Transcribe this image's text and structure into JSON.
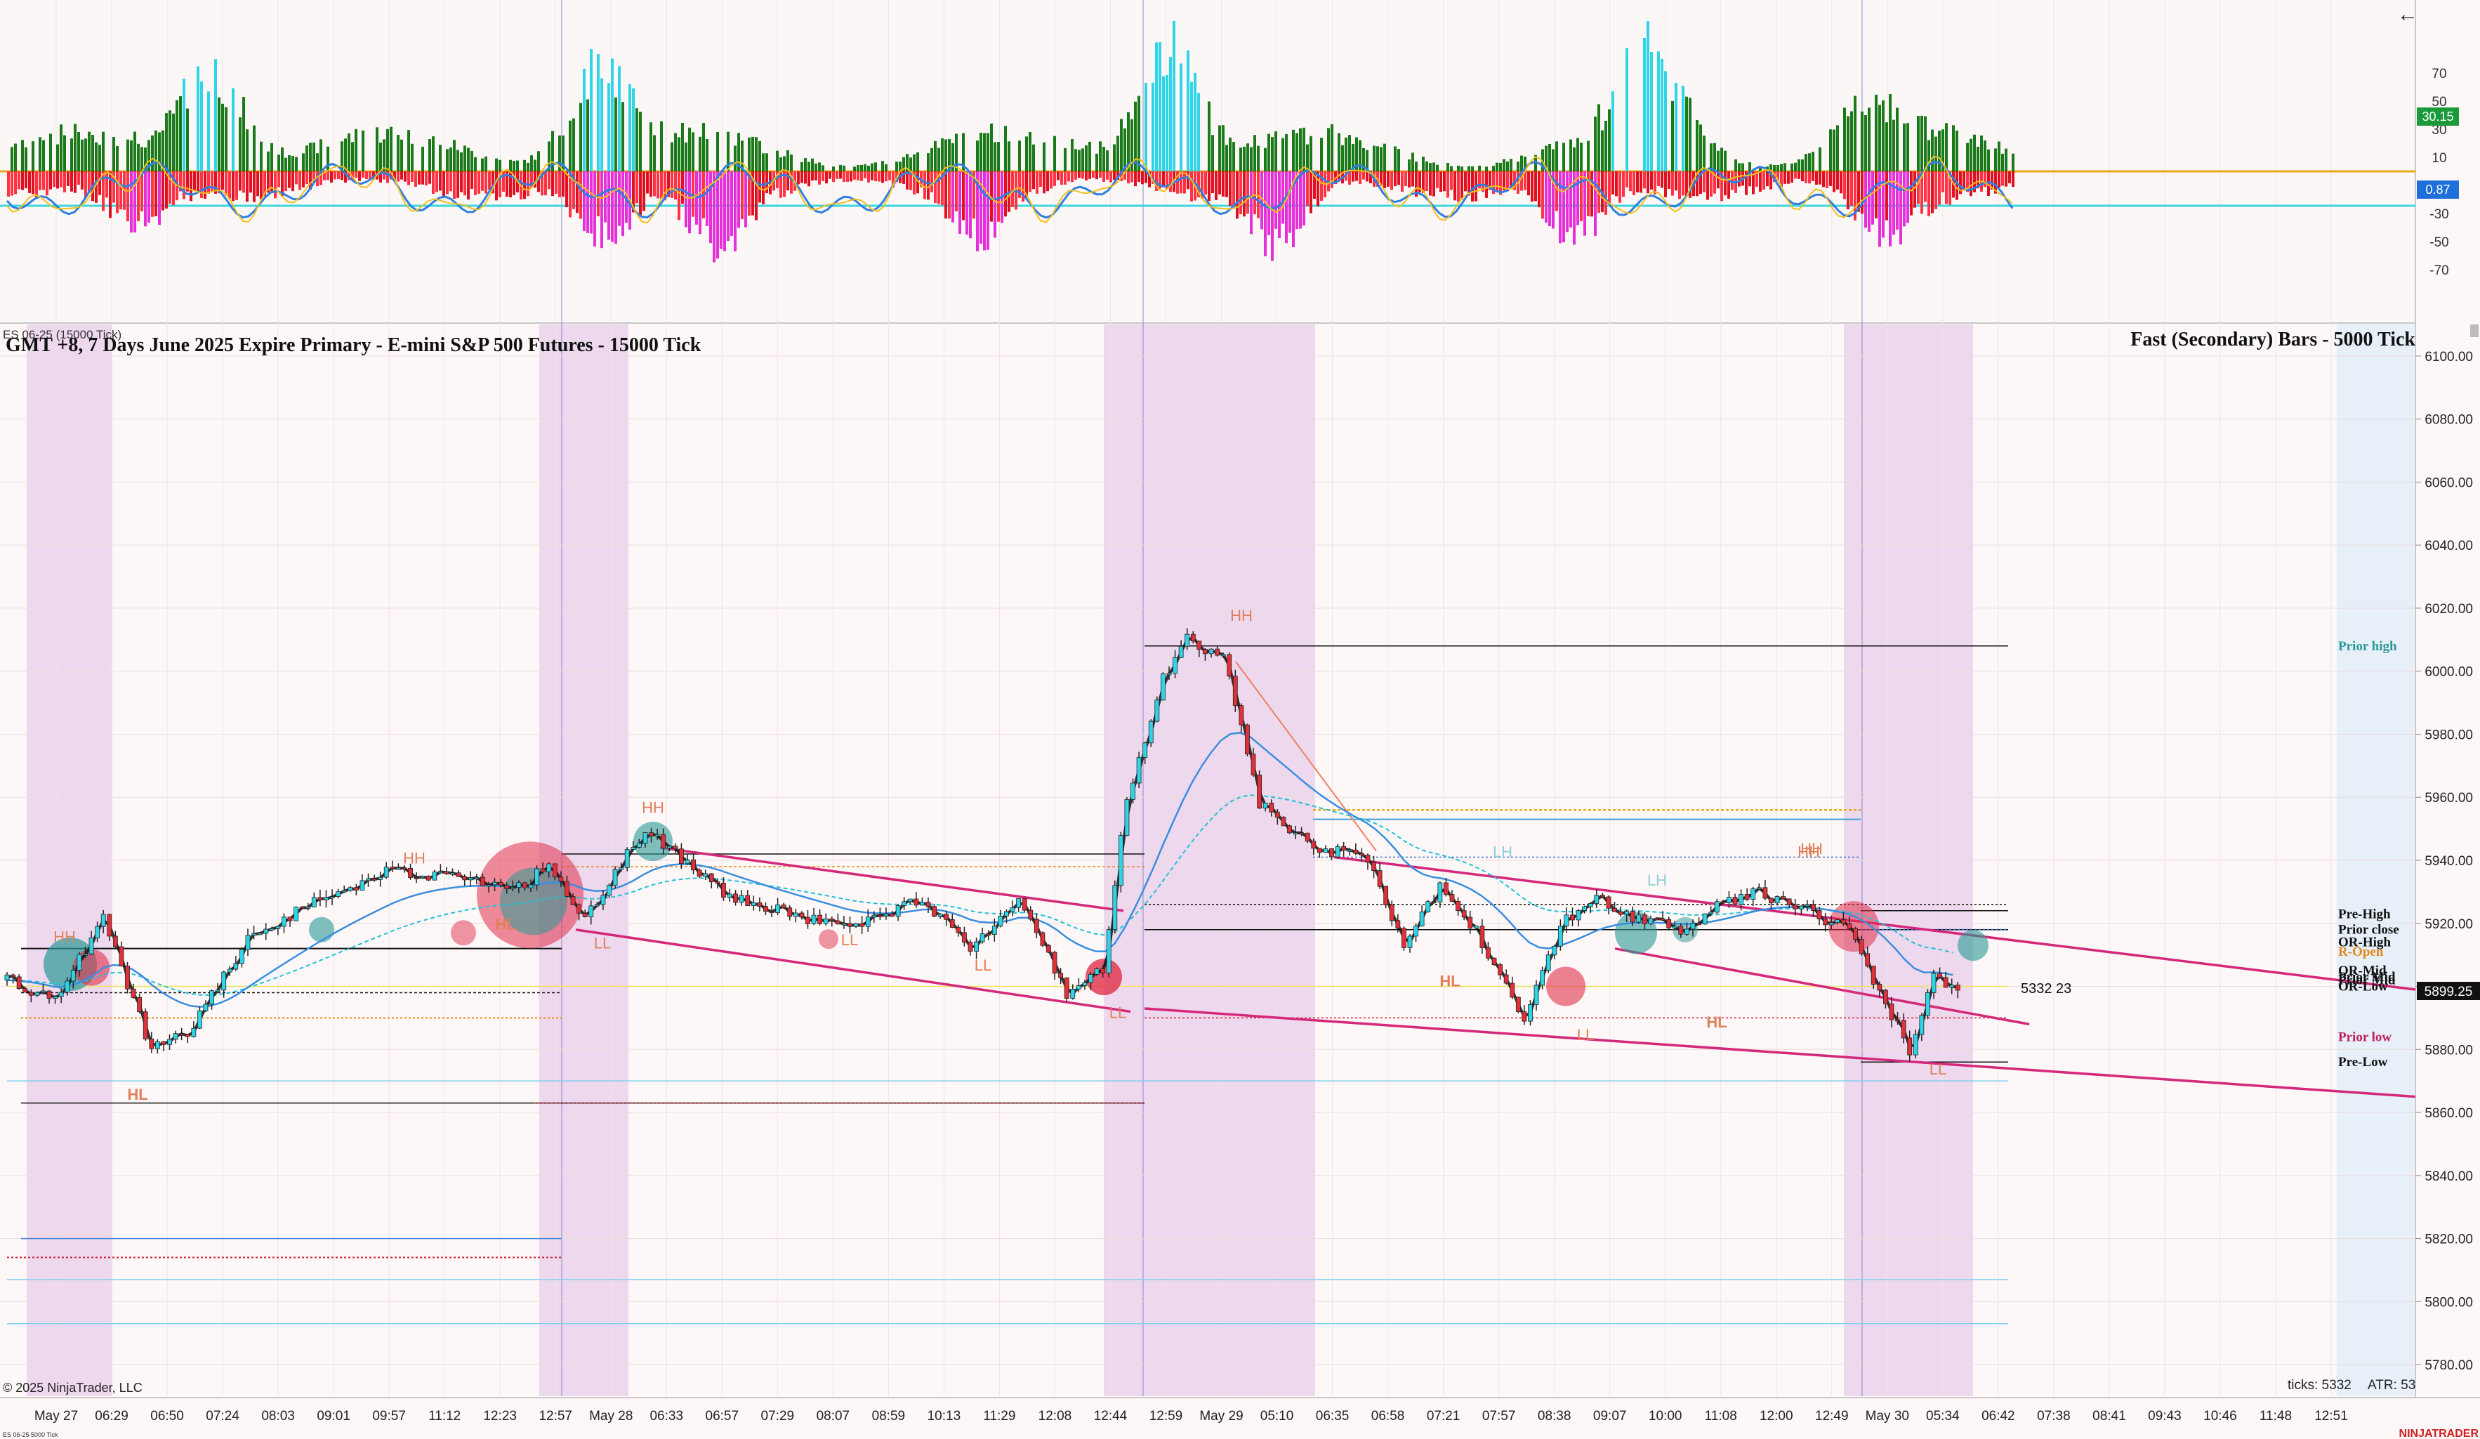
{
  "header": {
    "instrument_tag": "ES 06-25 (15000 Tick)",
    "title": "GMT +8, 7 Days June 2025 Expire Primary   - E-mini S&P 500 Futures - 15000 Tick",
    "secondary_title": "Fast (Secondary) Bars - 5000 Tick",
    "copyright": "© 2025 NinjaTrader, LLC",
    "brand": "NINJATRADER",
    "mini_label": "ES 06-25 5000 Tick",
    "back_arrow": "←"
  },
  "status": {
    "ticks": "ticks: 5332",
    "atr": "ATR: 53",
    "bar_counter": "5332  23"
  },
  "price_badges": {
    "current_price": "5899.25",
    "current_price_color": "#111111"
  },
  "oscillator": {
    "y_ticks": [
      "70",
      "50",
      "30",
      "10",
      "-30",
      "-50",
      "-70"
    ],
    "value_badge": "30.15",
    "value_badge_color": "#1a9a3a",
    "signal_badge": "0.87",
    "signal_badge_color": "#1e6fd9"
  },
  "chart_data": {
    "type": "candlestick",
    "title": "GMT +8, 7 Days June 2025 Expire Primary   - E-mini S&P 500 Futures - 15000 Tick",
    "ylim": [
      5770,
      6110
    ],
    "y_ticks": [
      "6100.00",
      "6080.00",
      "6060.00",
      "6040.00",
      "6020.00",
      "6000.00",
      "5980.00",
      "5960.00",
      "5940.00",
      "5920.00",
      "5900.00",
      "5880.00",
      "5860.00",
      "5840.00",
      "5820.00",
      "5800.00",
      "5780.00"
    ],
    "x_ticks": [
      "May 27",
      "06:29",
      "06:50",
      "07:24",
      "08:03",
      "09:01",
      "09:57",
      "11:12",
      "12:23",
      "12:57",
      "May 28",
      "06:33",
      "06:57",
      "07:29",
      "08:07",
      "08:59",
      "10:13",
      "11:29",
      "12:08",
      "12:44",
      "12:59",
      "May 29",
      "05:10",
      "06:35",
      "06:58",
      "07:21",
      "07:57",
      "08:38",
      "09:07",
      "10:00",
      "11:08",
      "12:00",
      "12:49",
      "May 30",
      "05:34",
      "06:42",
      "07:38",
      "08:41",
      "09:43",
      "10:46",
      "11:48",
      "12:51"
    ],
    "price_path": [
      [
        0,
        5902
      ],
      [
        0.02,
        5895
      ],
      [
        0.04,
        5922
      ],
      [
        0.06,
        5880
      ],
      [
        0.075,
        5885
      ],
      [
        0.1,
        5915
      ],
      [
        0.13,
        5928
      ],
      [
        0.16,
        5937
      ],
      [
        0.19,
        5934
      ],
      [
        0.21,
        5930
      ],
      [
        0.225,
        5938
      ],
      [
        0.24,
        5922
      ],
      [
        0.265,
        5950
      ],
      [
        0.3,
        5928
      ],
      [
        0.35,
        5918
      ],
      [
        0.38,
        5928
      ],
      [
        0.4,
        5912
      ],
      [
        0.42,
        5928
      ],
      [
        0.44,
        5898
      ],
      [
        0.455,
        5905
      ],
      [
        0.465,
        5960
      ],
      [
        0.48,
        5998
      ],
      [
        0.49,
        6010
      ],
      [
        0.505,
        6005
      ],
      [
        0.52,
        5958
      ],
      [
        0.54,
        5945
      ],
      [
        0.565,
        5940
      ],
      [
        0.58,
        5912
      ],
      [
        0.595,
        5932
      ],
      [
        0.61,
        5918
      ],
      [
        0.63,
        5888
      ],
      [
        0.645,
        5920
      ],
      [
        0.66,
        5928
      ],
      [
        0.675,
        5922
      ],
      [
        0.695,
        5918
      ],
      [
        0.71,
        5925
      ],
      [
        0.725,
        5930
      ],
      [
        0.745,
        5925
      ],
      [
        0.765,
        5918
      ],
      [
        0.78,
        5895
      ],
      [
        0.79,
        5880
      ],
      [
        0.8,
        5905
      ],
      [
        0.81,
        5898
      ]
    ],
    "levels": [
      "Prior high",
      "Pre-High",
      "Prior close",
      "OR-High",
      "R-Open",
      "OR-Mid",
      "Prior Mid",
      "Prior Mid",
      "OR-Low",
      "Prior low",
      "Pre-Low"
    ],
    "swing_labels": [
      "HH",
      "HH",
      "HL",
      "LL",
      "HH",
      "HL",
      "LL",
      "HH",
      "LL",
      "LL",
      "HH",
      "LH",
      "LH",
      "HL",
      "LL",
      "HL",
      "HH",
      "LL"
    ],
    "grid": true
  }
}
